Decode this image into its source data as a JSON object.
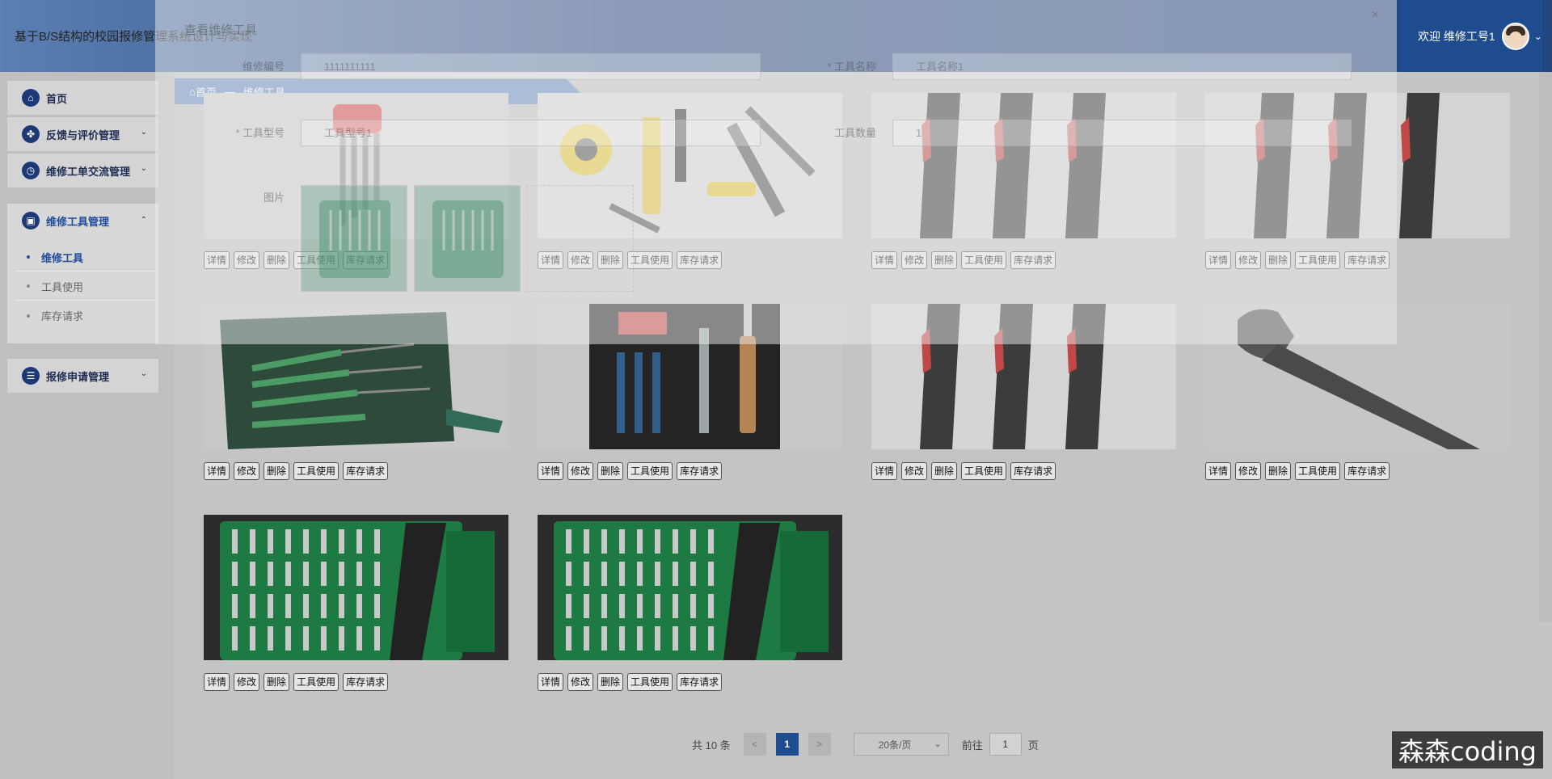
{
  "app": {
    "title": "基于B/S结构的校园报修管理系统设计与实现",
    "welcome": "欢迎 维修工号1"
  },
  "sidebar": {
    "home": "首页",
    "feedback": "反馈与评价管理",
    "workorder": "维修工单交流管理",
    "tools": "维修工具管理",
    "sub": [
      "维修工具",
      "工具使用",
      "库存请求"
    ],
    "repair": "报修申请管理"
  },
  "breadcrumb": {
    "home": "首页",
    "sep": "—",
    "current": "维修工具"
  },
  "card_buttons": [
    "详情",
    "修改",
    "删除",
    "工具使用",
    "库存请求"
  ],
  "cards": [
    {
      "image": "hex-key-set"
    },
    {
      "image": "assorted-hand-tools"
    },
    {
      "image": "black-handles"
    },
    {
      "image": "black-handles"
    },
    {
      "image": "tool-roll-kit"
    },
    {
      "image": "tool-bag"
    },
    {
      "image": "black-handles"
    },
    {
      "image": "adjustable-wrench"
    },
    {
      "image": "screwdriver-bit-set"
    },
    {
      "image": "screwdriver-bit-set"
    }
  ],
  "pagination": {
    "total": "共 10 条",
    "prev": "<",
    "page": "1",
    "next": ">",
    "size": "20条/页",
    "goto": "前往",
    "goto_value": "1",
    "page_unit": "页"
  },
  "dialog": {
    "title": "查看维修工具",
    "close": "×",
    "fields": {
      "repair_no_label": "维修编号",
      "repair_no_value": "1111111111",
      "tool_name_label": "* 工具名称",
      "tool_name_placeholder": "工具名称1",
      "tool_model_label": "* 工具型号",
      "tool_model_placeholder": "工具型号1",
      "tool_qty_label": "工具数量",
      "tool_qty_value": "1",
      "image_label": "图片"
    }
  },
  "watermark": "森森coding"
}
